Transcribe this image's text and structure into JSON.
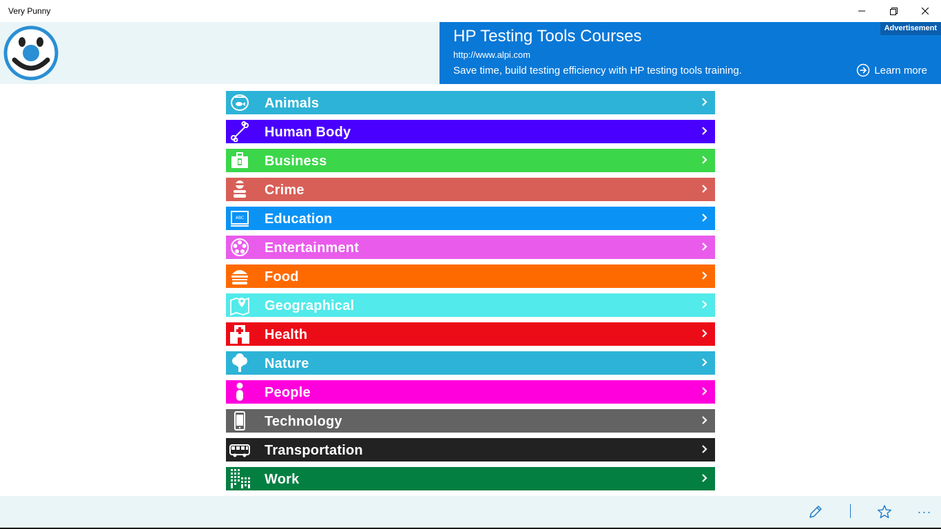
{
  "window": {
    "title": "Very Punny"
  },
  "ad": {
    "title": "HP Testing Tools Courses",
    "url": "http://www.alpi.com",
    "description": "Save time, build testing efficiency with HP testing tools training.",
    "badge": "Advertisement",
    "cta": "Learn more"
  },
  "categories": [
    {
      "label": "Animals",
      "icon": "fishbowl-icon",
      "color": "#2db3d7"
    },
    {
      "label": "Human Body",
      "icon": "bone-icon",
      "color": "#4a00ff"
    },
    {
      "label": "Business",
      "icon": "briefcase-icon",
      "color": "#3cd64a"
    },
    {
      "label": "Crime",
      "icon": "robber-icon",
      "color": "#d85f57"
    },
    {
      "label": "Education",
      "icon": "blackboard-icon",
      "color": "#0a93f5"
    },
    {
      "label": "Entertainment",
      "icon": "film-reel-icon",
      "color": "#e95ceb"
    },
    {
      "label": "Food",
      "icon": "burger-icon",
      "color": "#ff6a00"
    },
    {
      "label": "Geographical",
      "icon": "map-pin-icon",
      "color": "#52eaea"
    },
    {
      "label": "Health",
      "icon": "hospital-icon",
      "color": "#ec0c18"
    },
    {
      "label": "Nature",
      "icon": "tree-icon",
      "color": "#2db3d7"
    },
    {
      "label": "People",
      "icon": "person-icon",
      "color": "#ff00dd"
    },
    {
      "label": "Technology",
      "icon": "phone-icon",
      "color": "#636363"
    },
    {
      "label": "Transportation",
      "icon": "bus-icon",
      "color": "#222222"
    },
    {
      "label": "Work",
      "icon": "buildings-icon",
      "color": "#047f42"
    }
  ],
  "bottom_bar": {
    "edit_icon": "pencil-icon",
    "favorite_icon": "star-icon",
    "more": "···"
  }
}
